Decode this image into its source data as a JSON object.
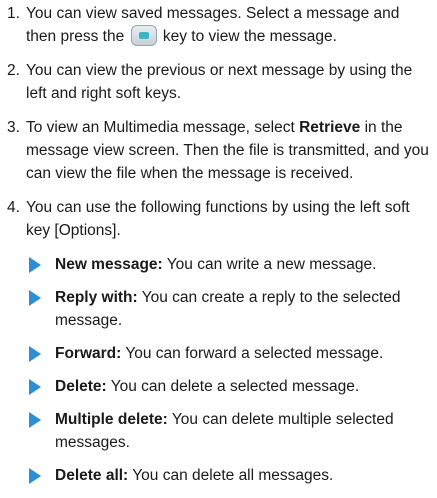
{
  "steps": [
    {
      "num": "1.",
      "text_before_key": "You can view saved messages. Select a message and then press the",
      "key_icon": "ok-key-icon",
      "text_after_key": "key to view the message."
    },
    {
      "num": "2.",
      "text": "You can view the previous or next message by using the left and right soft keys."
    },
    {
      "num": "3.",
      "text_before": "To view an Multimedia message, select",
      "bold": "Retrieve",
      "text_after": "in the message view screen. Then the file is transmitted, and you can view the file when the message is received."
    },
    {
      "num": "4.",
      "text": "You can use the following functions by using the left soft key [Options]."
    }
  ],
  "options": [
    {
      "label": "New message:",
      "desc": "You can write a new message."
    },
    {
      "label": "Reply with:",
      "desc": "You can create a reply to the selected message."
    },
    {
      "label": "Forward:",
      "desc": "You can forward a selected message."
    },
    {
      "label": "Delete:",
      "desc": "You can delete a selected message."
    },
    {
      "label": "Multiple delete:",
      "desc": "You can delete multiple selected messages."
    },
    {
      "label": "Delete all:",
      "desc": "You can delete all messages."
    }
  ],
  "colors": {
    "bullet": "#2a8fd6",
    "text": "#1a1a1a"
  }
}
